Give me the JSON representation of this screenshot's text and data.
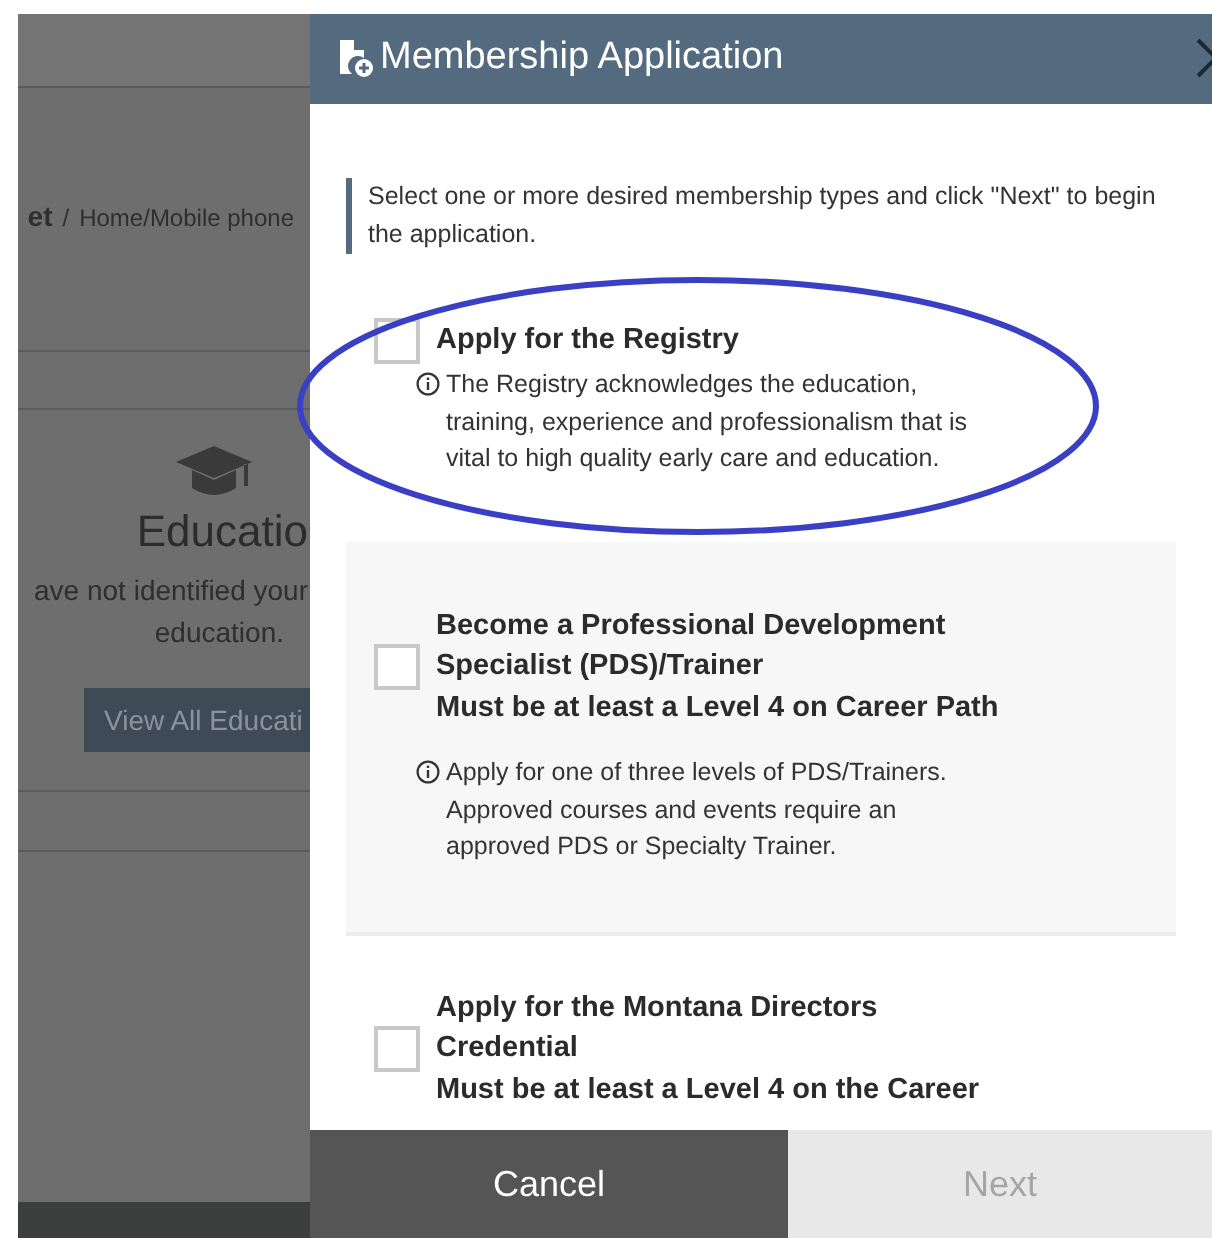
{
  "background_page": {
    "breadcrumb": [
      {
        "text": "et",
        "bold": true
      },
      {
        "text": "/",
        "bold": false
      },
      {
        "text": "Home/Mobile phone",
        "bold": false
      }
    ],
    "education_card": {
      "title": "Educatio",
      "message_lines": [
        "ave not identified your",
        "education."
      ],
      "button": "View All Educati"
    }
  },
  "modal": {
    "title": "Membership Application",
    "intro": "Select one or more desired membership types and click \"Next\" to begin the application.",
    "options": [
      {
        "title": "Apply for the Registry",
        "description": "The Registry acknowledges the education, training, experience and professionalism that is vital to high quality early care and education.",
        "checked": false,
        "shaded": false,
        "annotated": true
      },
      {
        "title": "Become a Professional Development Specialist (PDS)/Trainer",
        "requirement": "Must be at least a Level 4 on Career Path",
        "description": "Apply for one of three levels of PDS/Trainers. Approved courses and events require an approved PDS or Specialty Trainer.",
        "checked": false,
        "shaded": true,
        "annotated": false
      },
      {
        "title": "Apply for the Montana Directors Credential",
        "requirement": "Must be at least a Level 4 on the Career",
        "checked": false,
        "shaded": false,
        "annotated": false
      }
    ],
    "buttons": [
      {
        "label": "Cancel",
        "kind": "secondary",
        "disabled": false
      },
      {
        "label": "Next",
        "kind": "primary",
        "disabled": true
      }
    ]
  }
}
